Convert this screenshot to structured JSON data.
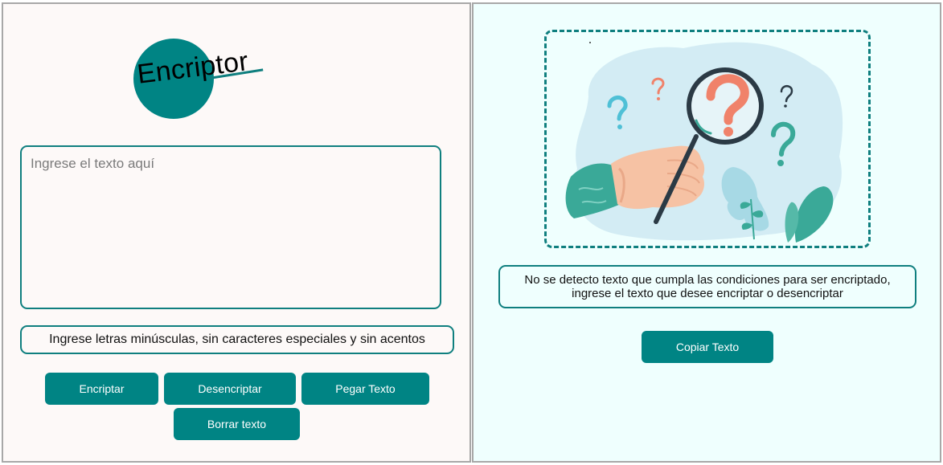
{
  "logo": {
    "text": "Encriptor"
  },
  "input": {
    "placeholder": "Ingrese el texto aquí",
    "value": ""
  },
  "hint": {
    "text": "Ingrese letras minúsculas, sin caracteres especiales y sin acentos"
  },
  "buttons": {
    "encrypt": "Encriptar",
    "decrypt": "Desencriptar",
    "paste": "Pegar Texto",
    "clear": "Borrar texto",
    "copy": "Copiar Texto"
  },
  "result": {
    "line1": "No se detecto texto que cumpla las condiciones para ser encriptado,",
    "line2": "ingrese el texto que desee encriptar o desencriptar"
  },
  "illustration": {
    "icon": "magnifier-question-illustration"
  },
  "colors": {
    "accent": "#008484",
    "left_bg": "#fdf9f8",
    "right_bg": "#effffe",
    "border": "#a8a8a8"
  }
}
